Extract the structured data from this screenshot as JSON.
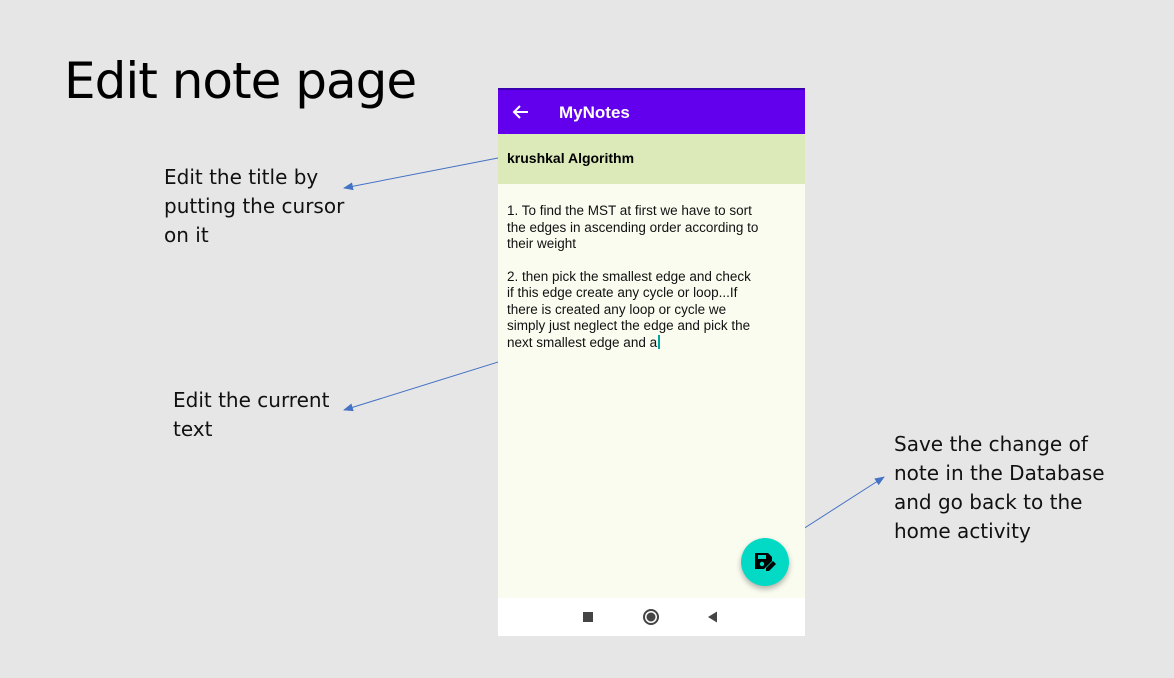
{
  "slide": {
    "title": "Edit note page"
  },
  "callouts": {
    "title_edit": [
      "Edit the title by",
      "putting the cursor",
      "on it"
    ],
    "text_edit": [
      "Edit the current",
      "text"
    ],
    "save": [
      "Save the change of",
      "note in the Database",
      "and go back to the",
      "home activity"
    ]
  },
  "app": {
    "title": "MyNotes",
    "back_icon": "arrow-left-icon",
    "colors": {
      "appbar": "#6200ee",
      "title_field": "#dce9b9",
      "fab": "#03dac5",
      "arrows": "#4472c4"
    },
    "note": {
      "title": "krushkal Algorithm",
      "paragraphs": [
        [
          "1. To find the MST at first we have to sort",
          "the edges in ascending order according to",
          "their weight"
        ],
        [
          "2. then pick the smallest edge and check",
          "if this edge create any cycle or loop...If",
          "there is created any loop or cycle we",
          "simply just neglect the edge and pick the",
          "next smallest edge and a"
        ]
      ]
    },
    "fab_icon": "save-edit-icon",
    "navbar": {
      "recents": "square-icon",
      "home": "circle-icon",
      "back": "triangle-back-icon"
    }
  }
}
